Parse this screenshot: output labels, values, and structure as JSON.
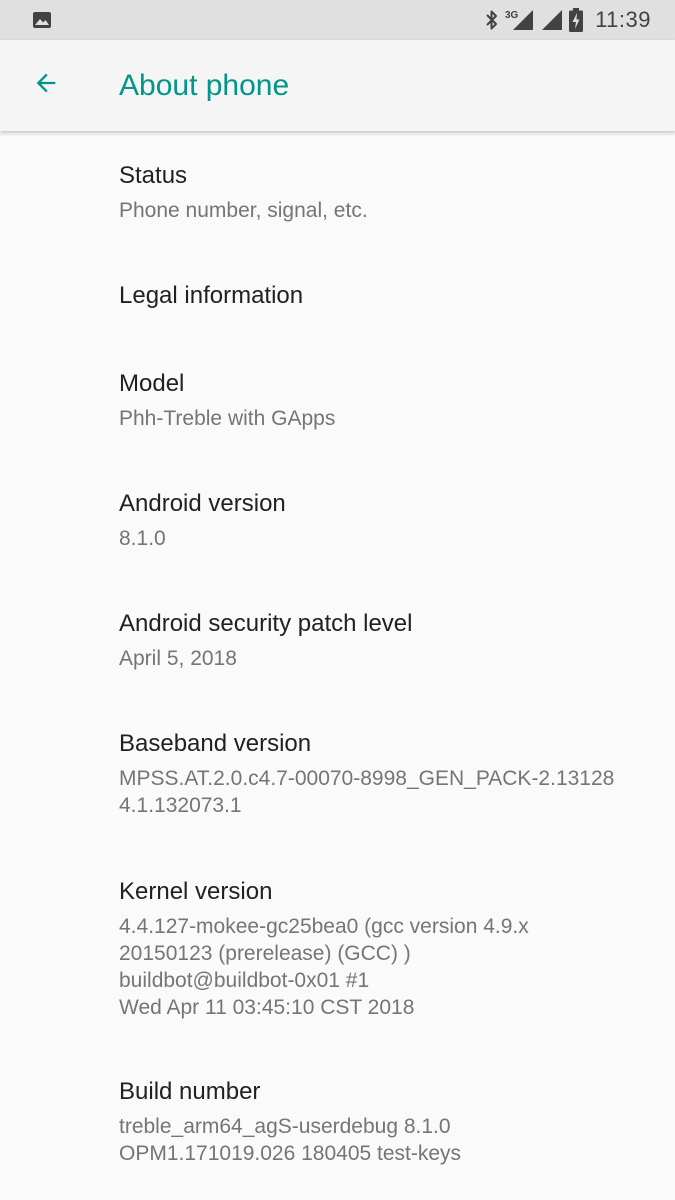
{
  "status_bar": {
    "time": "11:39",
    "network_label": "3G",
    "icons": [
      "image-notification-icon",
      "bluetooth-icon",
      "mobile-signal-3g-icon",
      "wifi-signal-icon",
      "battery-charging-icon"
    ]
  },
  "app_bar": {
    "title": "About phone",
    "back_icon": "arrow-back-icon",
    "accent_color": "#009688"
  },
  "items": [
    {
      "title": "Status",
      "summary": [
        "Phone number, signal, etc."
      ]
    },
    {
      "title": "Legal information",
      "summary": []
    },
    {
      "title": "Model",
      "summary": [
        "Phh-Treble with GApps"
      ]
    },
    {
      "title": "Android version",
      "summary": [
        "8.1.0"
      ]
    },
    {
      "title": "Android security patch level",
      "summary": [
        "April 5, 2018"
      ]
    },
    {
      "title": "Baseband version",
      "summary": [
        "MPSS.AT.2.0.c4.7-00070-8998_GEN_PACK-2.13128",
        "4.1.132073.1"
      ]
    },
    {
      "title": "Kernel version",
      "summary": [
        "4.4.127-mokee-gc25bea0 (gcc version 4.9.x",
        "20150123 (prerelease) (GCC) )",
        "buildbot@buildbot-0x01 #1",
        "Wed Apr 11 03:45:10 CST 2018"
      ]
    },
    {
      "title": "Build number",
      "summary": [
        "treble_arm64_agS-userdebug 8.1.0",
        "OPM1.171019.026 180405 test-keys"
      ]
    }
  ]
}
